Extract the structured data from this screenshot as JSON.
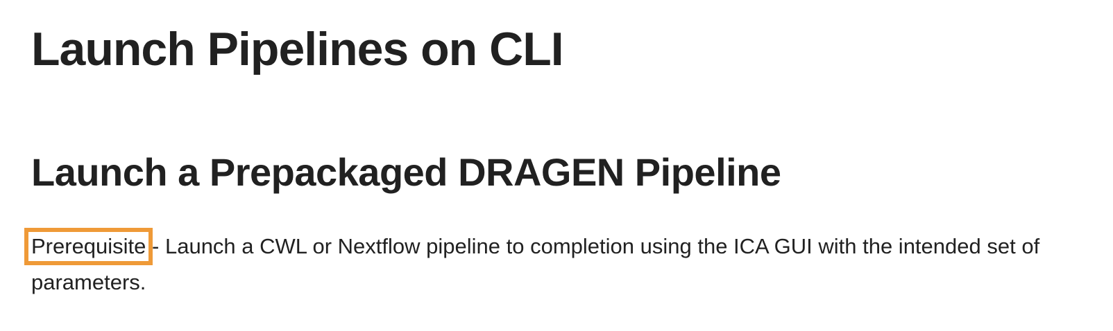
{
  "page": {
    "title": "Launch Pipelines on CLI",
    "section_heading": "Launch a Prepackaged DRAGEN Pipeline",
    "paragraph": {
      "highlighted_term": "Prerequisite",
      "rest": " - Launch a CWL or Nextflow pipeline to completion using the ICA GUI with the intended set of parameters."
    }
  },
  "colors": {
    "text": "#212121",
    "highlight_border": "#ef9a38",
    "background": "#ffffff"
  }
}
